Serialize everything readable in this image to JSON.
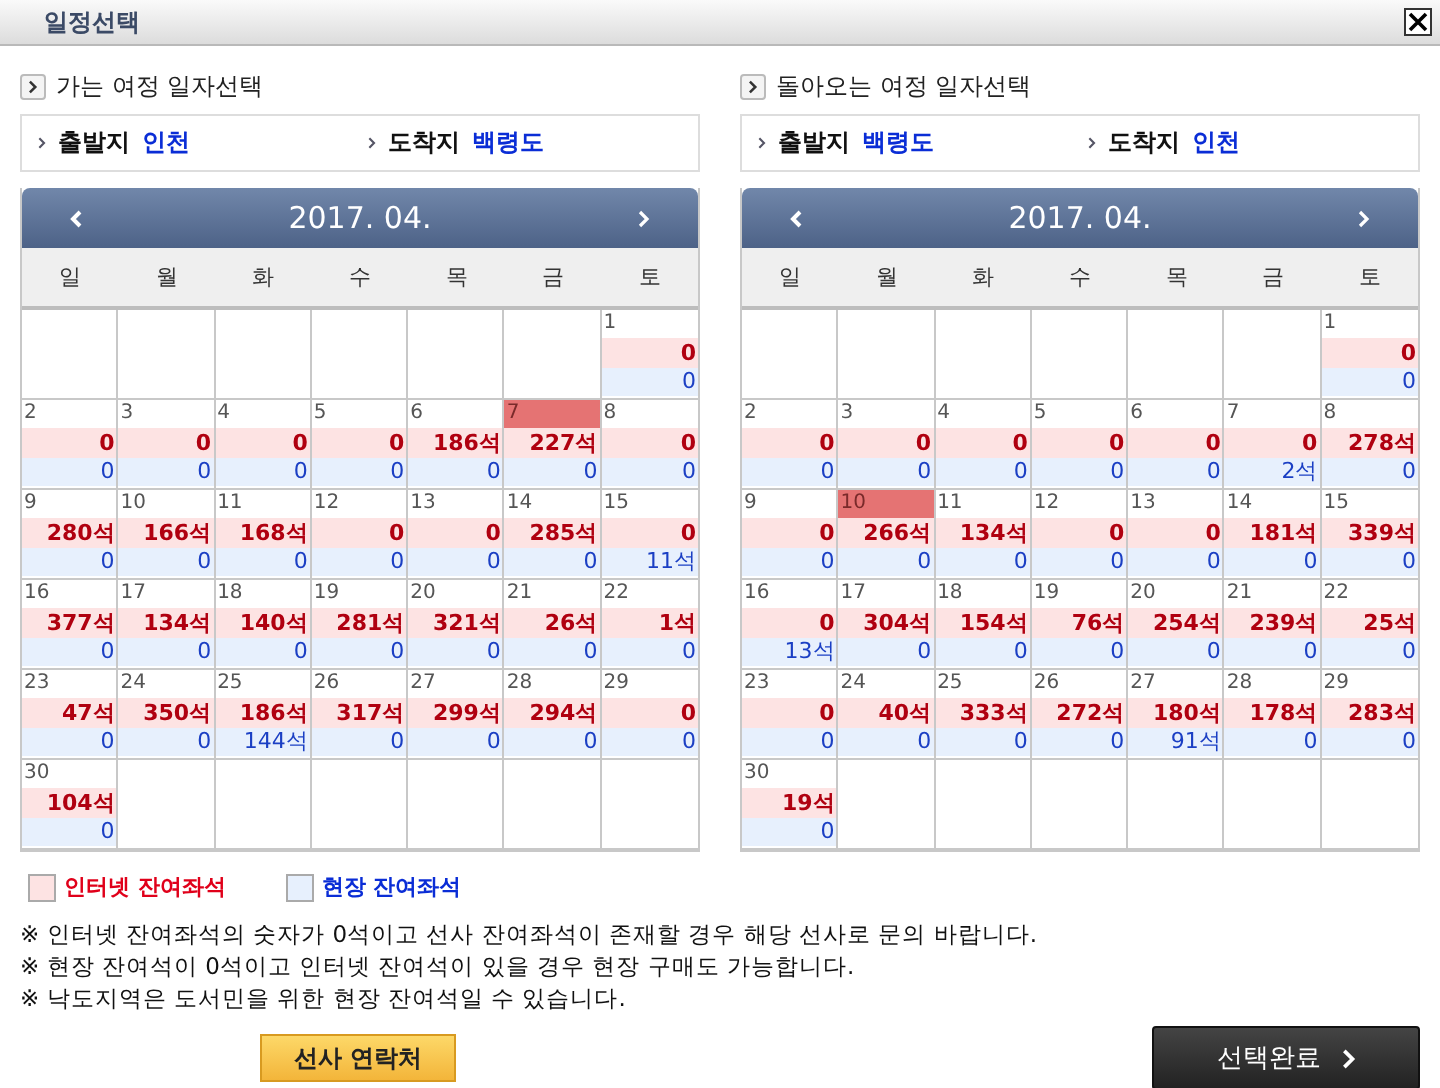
{
  "window": {
    "title": "일정선택"
  },
  "panels": [
    {
      "heading": "가는 여정 일자선택",
      "route": [
        {
          "label": "출발지",
          "value": "인천"
        },
        {
          "label": "도착지",
          "value": "백령도"
        }
      ],
      "calendar": {
        "month": "2017. 04.",
        "weekdays": [
          "일",
          "월",
          "화",
          "수",
          "목",
          "금",
          "토"
        ],
        "weeks": [
          {
            "kind": "first",
            "days": [
              {
                "day": "1",
                "internet": "0",
                "onsite": "0",
                "selected": false
              }
            ]
          },
          {
            "kind": "full",
            "days": [
              {
                "day": "2",
                "internet": "0",
                "onsite": "0",
                "selected": false
              },
              {
                "day": "3",
                "internet": "0",
                "onsite": "0",
                "selected": false
              },
              {
                "day": "4",
                "internet": "0",
                "onsite": "0",
                "selected": false
              },
              {
                "day": "5",
                "internet": "0",
                "onsite": "0",
                "selected": false
              },
              {
                "day": "6",
                "internet": "186석",
                "onsite": "0",
                "selected": false
              },
              {
                "day": "7",
                "internet": "227석",
                "onsite": "0",
                "selected": true
              },
              {
                "day": "8",
                "internet": "0",
                "onsite": "0",
                "selected": false
              }
            ]
          },
          {
            "kind": "full",
            "days": [
              {
                "day": "9",
                "internet": "280석",
                "onsite": "0",
                "selected": false
              },
              {
                "day": "10",
                "internet": "166석",
                "onsite": "0",
                "selected": false
              },
              {
                "day": "11",
                "internet": "168석",
                "onsite": "0",
                "selected": false
              },
              {
                "day": "12",
                "internet": "0",
                "onsite": "0",
                "selected": false
              },
              {
                "day": "13",
                "internet": "0",
                "onsite": "0",
                "selected": false
              },
              {
                "day": "14",
                "internet": "285석",
                "onsite": "0",
                "selected": false
              },
              {
                "day": "15",
                "internet": "0",
                "onsite": "11석",
                "selected": false
              }
            ]
          },
          {
            "kind": "full",
            "days": [
              {
                "day": "16",
                "internet": "377석",
                "onsite": "0",
                "selected": false
              },
              {
                "day": "17",
                "internet": "134석",
                "onsite": "0",
                "selected": false
              },
              {
                "day": "18",
                "internet": "140석",
                "onsite": "0",
                "selected": false
              },
              {
                "day": "19",
                "internet": "281석",
                "onsite": "0",
                "selected": false
              },
              {
                "day": "20",
                "internet": "321석",
                "onsite": "0",
                "selected": false
              },
              {
                "day": "21",
                "internet": "26석",
                "onsite": "0",
                "selected": false
              },
              {
                "day": "22",
                "internet": "1석",
                "onsite": "0",
                "selected": false
              }
            ]
          },
          {
            "kind": "full",
            "days": [
              {
                "day": "23",
                "internet": "47석",
                "onsite": "0",
                "selected": false
              },
              {
                "day": "24",
                "internet": "350석",
                "onsite": "0",
                "selected": false
              },
              {
                "day": "25",
                "internet": "186석",
                "onsite": "144석",
                "selected": false
              },
              {
                "day": "26",
                "internet": "317석",
                "onsite": "0",
                "selected": false
              },
              {
                "day": "27",
                "internet": "299석",
                "onsite": "0",
                "selected": false
              },
              {
                "day": "28",
                "internet": "294석",
                "onsite": "0",
                "selected": false
              },
              {
                "day": "29",
                "internet": "0",
                "onsite": "0",
                "selected": false
              }
            ]
          },
          {
            "kind": "last",
            "days": [
              {
                "day": "30",
                "internet": "104석",
                "onsite": "0",
                "selected": false
              }
            ]
          }
        ]
      }
    },
    {
      "heading": "돌아오는 여정 일자선택",
      "route": [
        {
          "label": "출발지",
          "value": "백령도"
        },
        {
          "label": "도착지",
          "value": "인천"
        }
      ],
      "calendar": {
        "month": "2017. 04.",
        "weekdays": [
          "일",
          "월",
          "화",
          "수",
          "목",
          "금",
          "토"
        ],
        "weeks": [
          {
            "kind": "first",
            "days": [
              {
                "day": "1",
                "internet": "0",
                "onsite": "0",
                "selected": false
              }
            ]
          },
          {
            "kind": "full",
            "days": [
              {
                "day": "2",
                "internet": "0",
                "onsite": "0",
                "selected": false
              },
              {
                "day": "3",
                "internet": "0",
                "onsite": "0",
                "selected": false
              },
              {
                "day": "4",
                "internet": "0",
                "onsite": "0",
                "selected": false
              },
              {
                "day": "5",
                "internet": "0",
                "onsite": "0",
                "selected": false
              },
              {
                "day": "6",
                "internet": "0",
                "onsite": "0",
                "selected": false
              },
              {
                "day": "7",
                "internet": "0",
                "onsite": "2석",
                "selected": false
              },
              {
                "day": "8",
                "internet": "278석",
                "onsite": "0",
                "selected": false
              }
            ]
          },
          {
            "kind": "full",
            "days": [
              {
                "day": "9",
                "internet": "0",
                "onsite": "0",
                "selected": false
              },
              {
                "day": "10",
                "internet": "266석",
                "onsite": "0",
                "selected": true
              },
              {
                "day": "11",
                "internet": "134석",
                "onsite": "0",
                "selected": false
              },
              {
                "day": "12",
                "internet": "0",
                "onsite": "0",
                "selected": false
              },
              {
                "day": "13",
                "internet": "0",
                "onsite": "0",
                "selected": false
              },
              {
                "day": "14",
                "internet": "181석",
                "onsite": "0",
                "selected": false
              },
              {
                "day": "15",
                "internet": "339석",
                "onsite": "0",
                "selected": false
              }
            ]
          },
          {
            "kind": "full",
            "days": [
              {
                "day": "16",
                "internet": "0",
                "onsite": "13석",
                "selected": false
              },
              {
                "day": "17",
                "internet": "304석",
                "onsite": "0",
                "selected": false
              },
              {
                "day": "18",
                "internet": "154석",
                "onsite": "0",
                "selected": false
              },
              {
                "day": "19",
                "internet": "76석",
                "onsite": "0",
                "selected": false
              },
              {
                "day": "20",
                "internet": "254석",
                "onsite": "0",
                "selected": false
              },
              {
                "day": "21",
                "internet": "239석",
                "onsite": "0",
                "selected": false
              },
              {
                "day": "22",
                "internet": "25석",
                "onsite": "0",
                "selected": false
              }
            ]
          },
          {
            "kind": "full",
            "days": [
              {
                "day": "23",
                "internet": "0",
                "onsite": "0",
                "selected": false
              },
              {
                "day": "24",
                "internet": "40석",
                "onsite": "0",
                "selected": false
              },
              {
                "day": "25",
                "internet": "333석",
                "onsite": "0",
                "selected": false
              },
              {
                "day": "26",
                "internet": "272석",
                "onsite": "0",
                "selected": false
              },
              {
                "day": "27",
                "internet": "180석",
                "onsite": "91석",
                "selected": false
              },
              {
                "day": "28",
                "internet": "178석",
                "onsite": "0",
                "selected": false
              },
              {
                "day": "29",
                "internet": "283석",
                "onsite": "0",
                "selected": false
              }
            ]
          },
          {
            "kind": "last",
            "days": [
              {
                "day": "30",
                "internet": "19석",
                "onsite": "0",
                "selected": false
              }
            ]
          }
        ]
      }
    }
  ],
  "legend": [
    {
      "label": "인터넷 잔여좌석",
      "kind": "internet"
    },
    {
      "label": "현장 잔여좌석",
      "kind": "onsite"
    }
  ],
  "notes": [
    "※ 인터넷 잔여좌석의 숫자가 0석이고 선사 잔여좌석이 존재할 경우 해당 선사로 문의 바랍니다.",
    "※ 현장 잔여석이 0석이고 인터넷 잔여석이 있을 경우 현장 구매도 가능합니다.",
    "※ 낙도지역은 도서민을 위한 현장 잔여석일 수 있습니다."
  ],
  "contact_button": "선사 연락처",
  "confirm_button": "선택완료"
}
